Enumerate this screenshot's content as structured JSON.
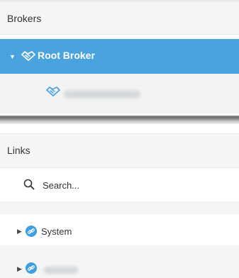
{
  "brokers": {
    "header": "Brokers",
    "root": {
      "label": "Root Broker",
      "expanded": true
    },
    "children": [
      {
        "label": ""
      }
    ]
  },
  "links": {
    "header": "Links",
    "search": {
      "placeholder": "Search..."
    },
    "items": [
      {
        "label": "System",
        "icon": "link-icon"
      },
      {
        "label": "",
        "icon": "link-icon"
      }
    ]
  },
  "colors": {
    "selected_bg": "#4aa3df",
    "header_bg": "#f5f5f5",
    "handshake_blue": "#4aa3df",
    "link_icon_blue": "#3d9fe0"
  }
}
